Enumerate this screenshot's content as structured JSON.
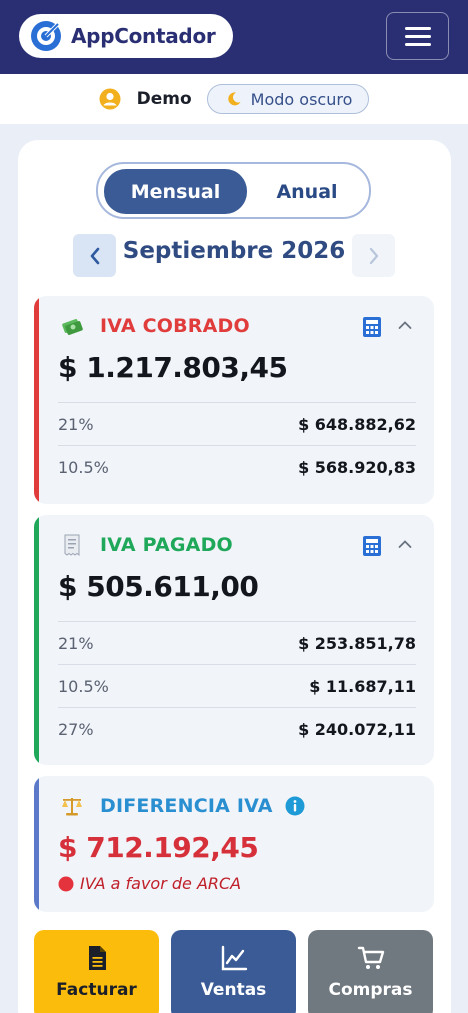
{
  "header": {
    "app_name": "AppContador",
    "logo_icon": "app-logo-icon",
    "menu_icon": "hamburger-menu-icon",
    "brand_color": "#2a2f74"
  },
  "userbar": {
    "user_name": "Demo",
    "user_icon": "user-avatar-icon",
    "dark_mode_label": "Modo oscuro",
    "dark_mode_icon": "moon-icon"
  },
  "period": {
    "tabs": [
      {
        "label": "Mensual",
        "active": true
      },
      {
        "label": "Anual",
        "active": false
      }
    ],
    "month_label": "Septiembre 2026",
    "prev_icon": "chevron-left-icon",
    "next_icon": "chevron-right-icon"
  },
  "iva_cobrado": {
    "title": "IVA COBRADO",
    "icon": "money-with-wings-icon",
    "accent": "#e03c3c",
    "total": "$ 1.217.803,45",
    "rows": [
      {
        "pct": "21%",
        "amount": "$ 648.882,62"
      },
      {
        "pct": "10.5%",
        "amount": "$ 568.920,83"
      }
    ]
  },
  "iva_pagado": {
    "title": "IVA PAGADO",
    "icon": "receipt-icon",
    "accent": "#1fa85a",
    "total": "$ 505.611,00",
    "rows": [
      {
        "pct": "21%",
        "amount": "$ 253.851,78"
      },
      {
        "pct": "10.5%",
        "amount": "$ 11.687,11"
      },
      {
        "pct": "27%",
        "amount": "$ 240.072,11"
      }
    ]
  },
  "diferencia": {
    "title": "DIFERENCIA IVA",
    "icon": "balance-scale-icon",
    "accent": "#5b79c8",
    "total": "$ 712.192,45",
    "status": "IVA a favor de ARCA",
    "status_color": "#c0202a"
  },
  "actions": [
    {
      "label": "Facturar",
      "icon": "document-icon",
      "color": "#fbbc0c"
    },
    {
      "label": "Ventas",
      "icon": "line-chart-icon",
      "color": "#3a5b96"
    },
    {
      "label": "Compras",
      "icon": "shopping-cart-icon",
      "color": "#707880"
    }
  ]
}
